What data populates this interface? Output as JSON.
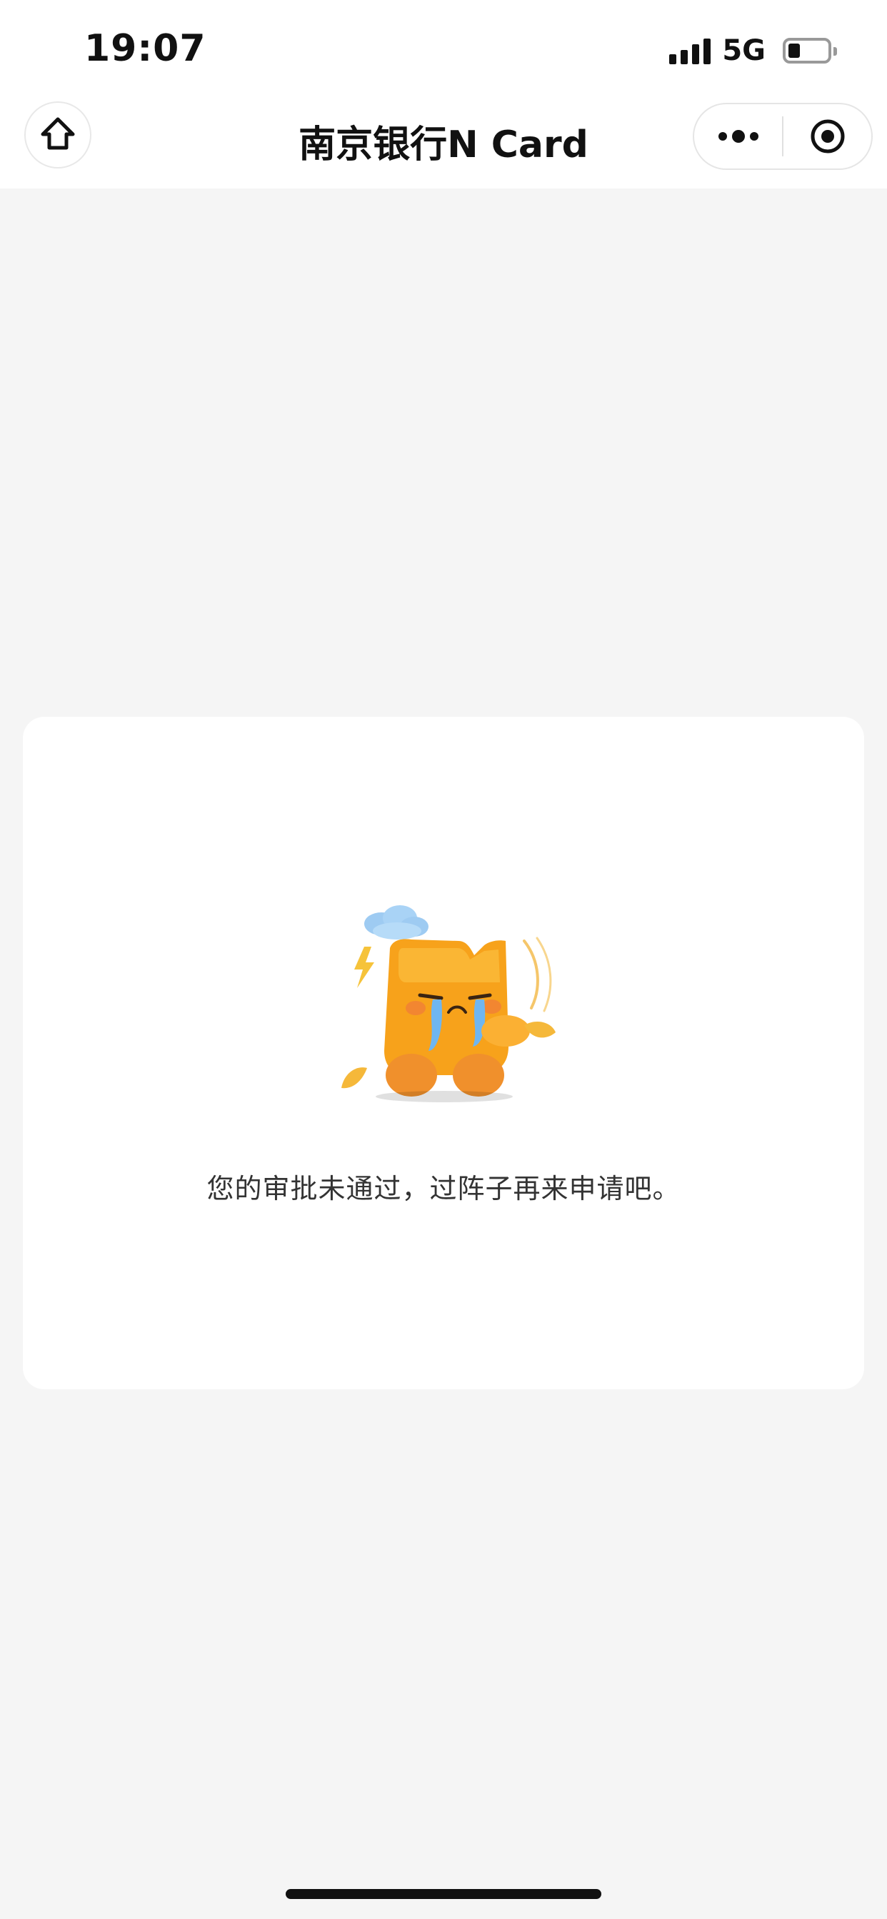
{
  "status_bar": {
    "time": "19:07",
    "network": "5G",
    "signal_icon": "signal-bars-icon",
    "battery_icon": "battery-icon",
    "battery_level": 0.3
  },
  "nav": {
    "title": "南京银行N Card",
    "home_icon": "home-icon",
    "more_icon": "more-dots-icon",
    "close_icon": "target-close-icon"
  },
  "result": {
    "message": "您的审批未通过，过阵子再来申请吧。",
    "illustration_icon": "crying-mascot-icon"
  },
  "colors": {
    "page_background": "#f5f5f5",
    "card_background": "#ffffff",
    "mascot_orange": "#f7a21b",
    "tear_blue": "#6fb6f0"
  }
}
